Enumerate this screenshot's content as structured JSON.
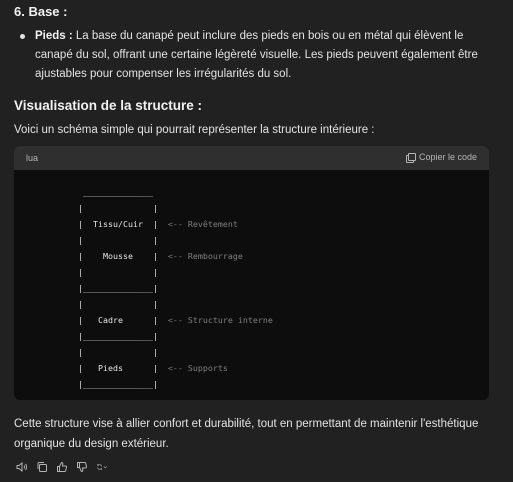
{
  "section": {
    "heading": "6. Base :",
    "bullet_term": "Pieds :",
    "bullet_text": " La base du canapé peut inclure des pieds en bois ou en métal qui élèvent le canapé du sol, offrant une certaine légèreté visuelle. Les pieds peuvent également être ajustables pour compenser les irrégularités du sol."
  },
  "visualisation": {
    "heading": "Visualisation de la structure :",
    "intro": "Voici un schéma simple qui pourrait représenter la structure intérieure :"
  },
  "codeblock": {
    "language": "lua",
    "copy_label": "Copier le code",
    "lines": [
      " ______________",
      "|              |",
      "|  Tissu/Cuir  |  <-- Revêtement",
      "|              |",
      "|    Mousse    |  <-- Rembourrage",
      "|              |",
      "|______________|",
      "|              |",
      "|   Cadre      |  <-- Structure interne",
      "|______________|",
      "|              |",
      "|   Pieds      |  <-- Supports",
      "|______________|"
    ]
  },
  "outro": "Cette structure vise à allier confort et durabilité, tout en permettant de maintenir l'esthétique organique du design extérieur.",
  "actions": {
    "icons": [
      "speaker-icon",
      "copy-icon",
      "thumbs-up-icon",
      "thumbs-down-icon",
      "regenerate-icon"
    ]
  },
  "colors": {
    "background": "#212121",
    "code_background": "#0d0d0d",
    "code_header": "#2f2f2f",
    "comment": "#7f7f7f"
  }
}
